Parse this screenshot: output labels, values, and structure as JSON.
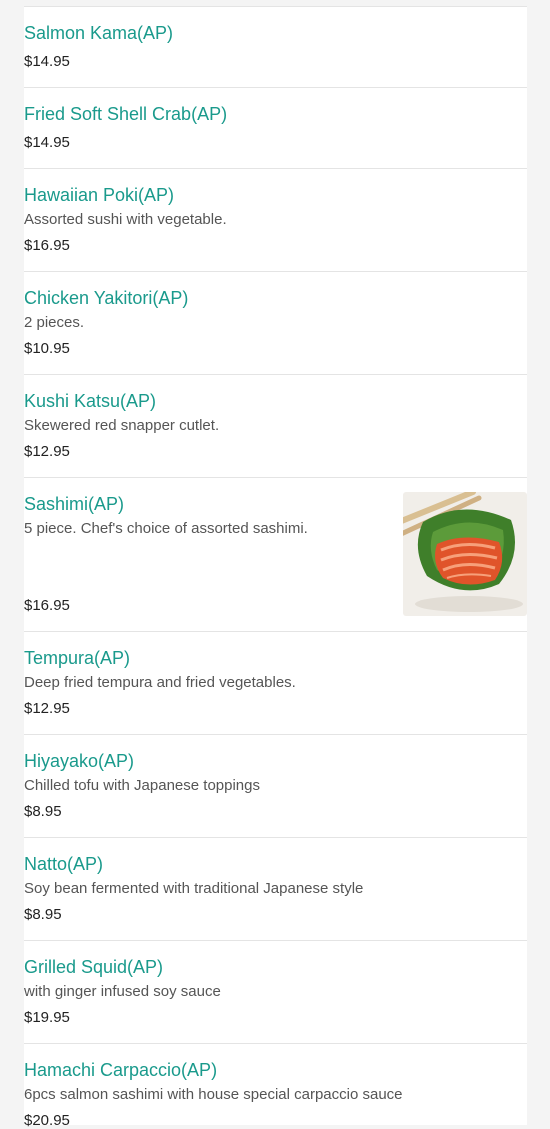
{
  "menu": {
    "items": [
      {
        "name": "Salmon Kama(AP)",
        "desc": "",
        "price": "$14.95"
      },
      {
        "name": "Fried Soft Shell Crab(AP)",
        "desc": "",
        "price": "$14.95"
      },
      {
        "name": "Hawaiian Poki(AP)",
        "desc": "Assorted sushi with vegetable.",
        "price": "$16.95"
      },
      {
        "name": "Chicken Yakitori(AP)",
        "desc": "2 pieces.",
        "price": "$10.95"
      },
      {
        "name": "Kushi Katsu(AP)",
        "desc": "Skewered red snapper cutlet.",
        "price": "$12.95"
      },
      {
        "name": "Sashimi(AP)",
        "desc": "5 piece. Chef's choice of assorted sashimi.",
        "price": "$16.95",
        "image": "sashimi-photo"
      },
      {
        "name": "Tempura(AP)",
        "desc": "Deep fried tempura and fried vegetables.",
        "price": "$12.95"
      },
      {
        "name": "Hiyayako(AP)",
        "desc": "Chilled tofu with Japanese toppings",
        "price": "$8.95"
      },
      {
        "name": "Natto(AP)",
        "desc": "Soy bean fermented with traditional Japanese style",
        "price": "$8.95"
      },
      {
        "name": "Grilled Squid(AP)",
        "desc": "with ginger infused soy sauce",
        "price": "$19.95"
      },
      {
        "name": "Hamachi Carpaccio(AP)",
        "desc": "6pcs salmon sashimi with house special carpaccio sauce",
        "price": "$20.95"
      }
    ]
  },
  "colors": {
    "item_name": "#1a9a8c",
    "background": "#f4f4f4",
    "divider": "#e4e4e4"
  }
}
